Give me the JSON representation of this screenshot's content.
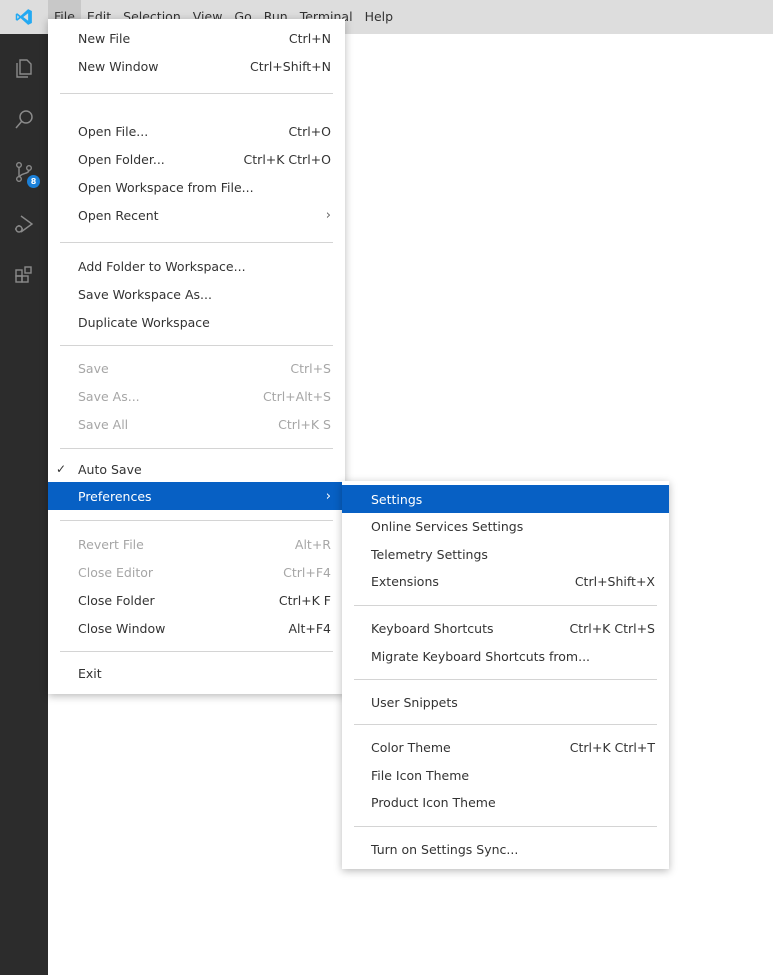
{
  "menubar": {
    "items": [
      "File",
      "Edit",
      "Selection",
      "View",
      "Go",
      "Run",
      "Terminal",
      "Help"
    ],
    "active_index": 0
  },
  "activity_bar": {
    "icons": [
      "explorer-icon",
      "search-icon",
      "source-control-icon",
      "run-debug-icon",
      "extensions-icon"
    ],
    "source_control_badge": "8"
  },
  "file_menu": {
    "groups": [
      [
        {
          "label": "New File",
          "shortcut": "Ctrl+N"
        },
        {
          "label": "New Window",
          "shortcut": "Ctrl+Shift+N"
        }
      ],
      [
        {
          "label": "Open File...",
          "shortcut": "Ctrl+O"
        },
        {
          "label": "Open Folder...",
          "shortcut": "Ctrl+K Ctrl+O"
        },
        {
          "label": "Open Workspace from File...",
          "shortcut": ""
        },
        {
          "label": "Open Recent",
          "shortcut": "",
          "submenu": true
        }
      ],
      [
        {
          "label": "Add Folder to Workspace...",
          "shortcut": ""
        },
        {
          "label": "Save Workspace As...",
          "shortcut": ""
        },
        {
          "label": "Duplicate Workspace",
          "shortcut": ""
        }
      ],
      [
        {
          "label": "Save",
          "shortcut": "Ctrl+S",
          "disabled": true
        },
        {
          "label": "Save As...",
          "shortcut": "Ctrl+Alt+S",
          "disabled": true
        },
        {
          "label": "Save All",
          "shortcut": "Ctrl+K S",
          "disabled": true
        }
      ],
      [
        {
          "label": "Auto Save",
          "shortcut": "",
          "checked": true
        },
        {
          "label": "Preferences",
          "shortcut": "",
          "submenu": true,
          "selected": true
        }
      ],
      [
        {
          "label": "Revert File",
          "shortcut": "Alt+R",
          "disabled": true
        },
        {
          "label": "Close Editor",
          "shortcut": "Ctrl+F4",
          "disabled": true
        },
        {
          "label": "Close Folder",
          "shortcut": "Ctrl+K F"
        },
        {
          "label": "Close Window",
          "shortcut": "Alt+F4"
        }
      ],
      [
        {
          "label": "Exit",
          "shortcut": ""
        }
      ]
    ]
  },
  "preferences_menu": {
    "groups": [
      [
        {
          "label": "Settings",
          "shortcut": "",
          "selected": true
        },
        {
          "label": "Online Services Settings",
          "shortcut": ""
        },
        {
          "label": "Telemetry Settings",
          "shortcut": ""
        },
        {
          "label": "Extensions",
          "shortcut": "Ctrl+Shift+X"
        }
      ],
      [
        {
          "label": "Keyboard Shortcuts",
          "shortcut": "Ctrl+K Ctrl+S"
        },
        {
          "label": "Migrate Keyboard Shortcuts from...",
          "shortcut": ""
        }
      ],
      [
        {
          "label": "User Snippets",
          "shortcut": ""
        }
      ],
      [
        {
          "label": "Color Theme",
          "shortcut": "Ctrl+K Ctrl+T"
        },
        {
          "label": "File Icon Theme",
          "shortcut": ""
        },
        {
          "label": "Product Icon Theme",
          "shortcut": ""
        }
      ],
      [
        {
          "label": "Turn on Settings Sync...",
          "shortcut": ""
        }
      ]
    ]
  },
  "colors": {
    "selection": "#0760c4",
    "activity_bar": "#2c2c2c",
    "title_bar": "#dddddd",
    "badge": "#1b80d8",
    "logo": "#23a9f2"
  }
}
